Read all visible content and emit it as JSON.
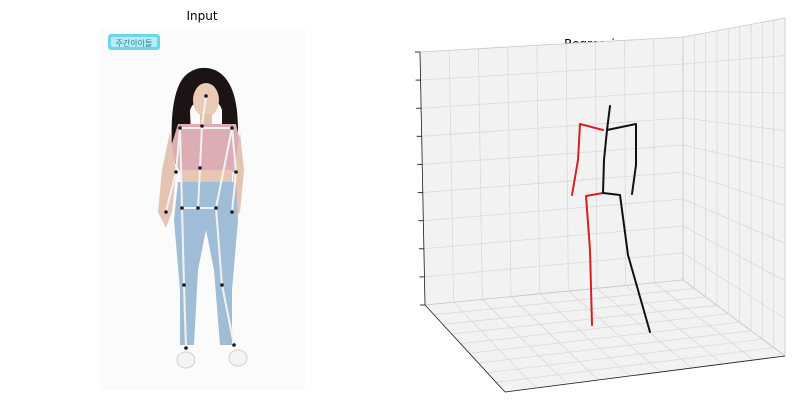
{
  "panels": {
    "input": {
      "title": "Input",
      "watermark": "주간아이돌"
    },
    "regression": {
      "title": "Regression"
    }
  },
  "colors": {
    "skeleton_overlay": "#f2f2f2",
    "joint_dot": "#1a1a1a",
    "pose_right_side": "#d42020",
    "pose_left_side": "#111111",
    "grid": "#d9d9d9",
    "pane": "#f2f2f2"
  },
  "icons": [
    "keypoint-dot-icon"
  ]
}
